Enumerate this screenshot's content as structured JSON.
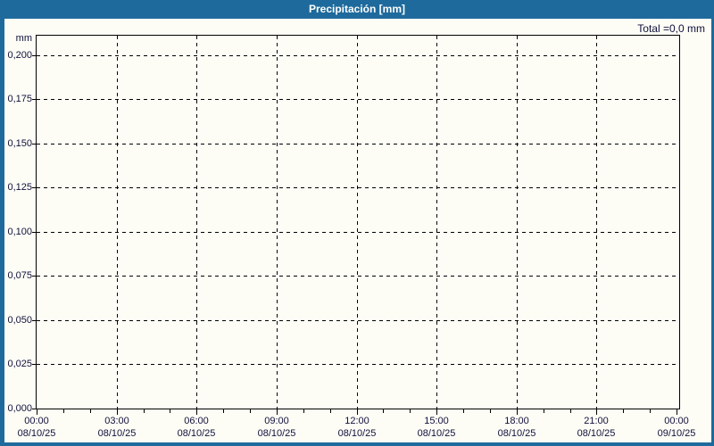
{
  "window": {
    "title": "Precipitación [mm]"
  },
  "summary": {
    "total_label": "Total =0,0 mm",
    "total_value_mm": "0,0"
  },
  "chart_data": {
    "type": "bar",
    "title": "Precipitación [mm]",
    "ylabel": "mm",
    "xlabel": "",
    "legend": "none",
    "grid": "dashed",
    "ylim": [
      0,
      0.211
    ],
    "xlim_hours": [
      0,
      24.1
    ],
    "yticks": [
      0.0,
      0.025,
      0.05,
      0.075,
      0.1,
      0.125,
      0.15,
      0.175,
      0.2
    ],
    "ytick_labels": [
      "0,000",
      "0,025",
      "0,050",
      "0,075",
      "0,100",
      "0,125",
      "0,150",
      "0,175",
      "0,200"
    ],
    "xticks_hours": [
      0,
      3,
      6,
      9,
      12,
      15,
      18,
      21,
      24
    ],
    "xtick_times": [
      "00:00",
      "03:00",
      "06:00",
      "09:00",
      "12:00",
      "15:00",
      "18:00",
      "21:00",
      "00:00"
    ],
    "xtick_dates": [
      "08/10/25",
      "08/10/25",
      "08/10/25",
      "08/10/25",
      "08/10/25",
      "08/10/25",
      "08/10/25",
      "08/10/25",
      "09/10/25"
    ],
    "xtick_minor_step_hours": 1,
    "series": [
      {
        "name": "Precipitación",
        "values": []
      }
    ],
    "total_mm": 0.0
  },
  "colors": {
    "frame_blue": "#1e6a9c",
    "title_text": "#ffffff",
    "axis_text": "#10103a",
    "grid_line": "#000000",
    "plot_background": "#fdfdf6"
  }
}
